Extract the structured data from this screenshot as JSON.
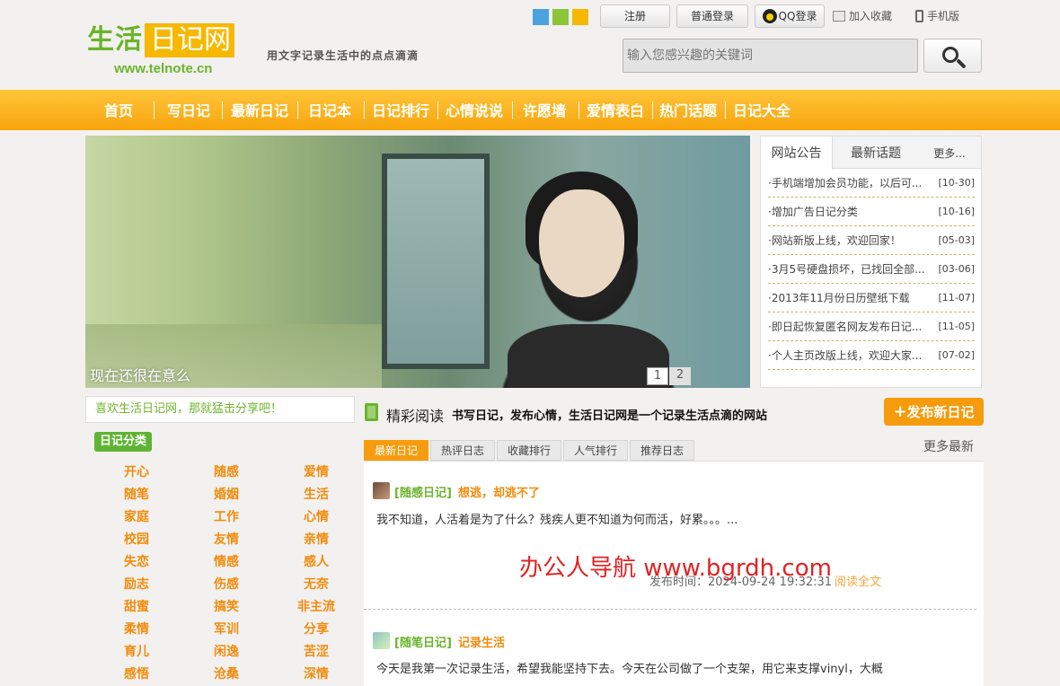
{
  "logo": {
    "part1": "生活",
    "part2": "日记网",
    "url": "www.telnote.cn"
  },
  "slogan": "用文字记录生活中的点点滴滴",
  "swatches": [
    "#4aa3df",
    "#8cc43a",
    "#f6b800"
  ],
  "header": {
    "register": "注册",
    "login": "普通登录",
    "qq_login": "QQ登录",
    "bookmark": "加入收藏",
    "mobile": "手机版"
  },
  "search": {
    "placeholder": "输入您感兴趣的关键词"
  },
  "nav": [
    "首页",
    "写日记",
    "最新日记",
    "日记本",
    "日记排行",
    "心情说说",
    "许愿墙",
    "爱情表白",
    "热门话题",
    "日记大全"
  ],
  "slider": {
    "caption": "现在还很在意么",
    "dots": [
      "1",
      "2"
    ]
  },
  "notice": {
    "tab_active": "网站公告",
    "tab_other": "最新话题",
    "more": "更多...",
    "items": [
      {
        "title": "手机端增加会员功能，以后可...",
        "date": "[10-30]"
      },
      {
        "title": "增加广告日记分类",
        "date": "[10-16]"
      },
      {
        "title": "网站新版上线，欢迎回家！",
        "date": "[05-03]"
      },
      {
        "title": "3月5号硬盘损坏，已找回全部...",
        "date": "[03-06]"
      },
      {
        "title": "2013年11月份日历壁纸下载",
        "date": "[11-07]"
      },
      {
        "title": "即日起恢复匿名网友发布日记...",
        "date": "[11-05]"
      },
      {
        "title": "个人主页改版上线，欢迎大家...",
        "date": "[07-02]"
      }
    ]
  },
  "share_text": "喜欢生活日记网，那就猛击分享吧！",
  "categories": {
    "label": "日记分类",
    "items": [
      "开心",
      "随感",
      "爱情",
      "随笔",
      "婚姻",
      "生活",
      "家庭",
      "工作",
      "心情",
      "校园",
      "友情",
      "亲情",
      "失恋",
      "情感",
      "感人",
      "励志",
      "伤感",
      "无奈",
      "甜蜜",
      "搞笑",
      "非主流",
      "柔情",
      "军训",
      "分享",
      "育儿",
      "闲逸",
      "苦涩",
      "感悟",
      "沧桑",
      "深情"
    ]
  },
  "reading": {
    "title": "精彩阅读",
    "subtitle": "书写日记，发布心情，生活日记网是一个记录生活点滴的网站",
    "publish": "发布新日记",
    "tabs": [
      "最新日记",
      "热评日志",
      "收藏排行",
      "人气排行",
      "推荐日志"
    ],
    "more": "更多最新"
  },
  "articles": [
    {
      "category": "[随感日记]",
      "title": "想逃，却逃不了",
      "excerpt": "我不知道，人活着是为了什么？残疾人更不知道为何而活，好累。。。...",
      "meta": "发布时间：2024-09-24 19:32:31",
      "readmore": "阅读全文"
    },
    {
      "category": "[随笔日记]",
      "title": "记录生活",
      "excerpt": "今天是我第一次记录生活，希望我能坚持下去。今天在公司做了一个支架，用它来支撑vinyl，大概"
    }
  ],
  "watermark": "办公人导航 www.bgrdh.com"
}
